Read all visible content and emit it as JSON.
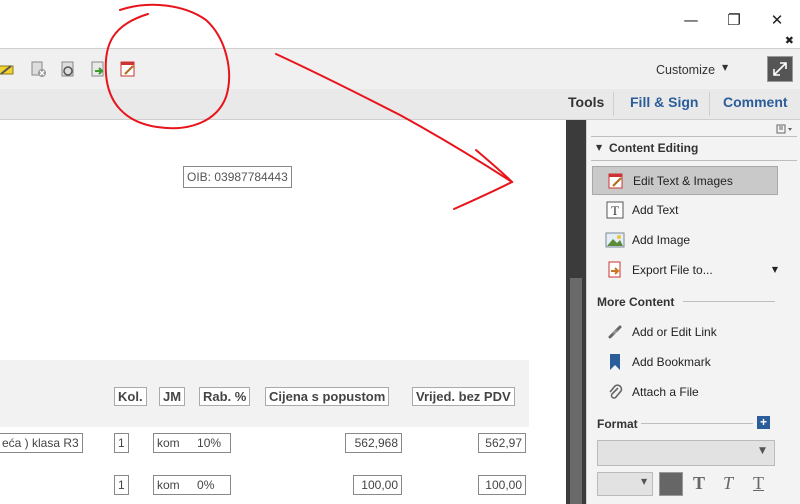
{
  "window": {
    "minimize": "—",
    "restore": "❐",
    "close": "✕",
    "doc_close": "✖"
  },
  "toolbar": {
    "icons": [
      "highlight-icon",
      "delete-page-icon",
      "attach-icon",
      "export-icon",
      "edit-text-icon"
    ],
    "customize_label": "Customize",
    "customize_caret": "▼"
  },
  "tasks": {
    "tools": "Tools",
    "fill_sign": "Fill & Sign",
    "comment": "Comment"
  },
  "document": {
    "oib": "OIB: 03987784443",
    "headers": [
      "Kol.",
      "JM",
      "Rab. %",
      "Cijena s popustom",
      "Vrijed. bez PDV"
    ],
    "rows": [
      {
        "desc": "eća ) klasa R3",
        "kol": "1",
        "jm": "kom",
        "rab": "10%",
        "cijena": "562,968",
        "vrijed": "562,97"
      },
      {
        "desc": "",
        "kol": "1",
        "jm": "kom",
        "rab": "0%",
        "cijena": "100,00",
        "vrijed": "100,00"
      }
    ]
  },
  "pane": {
    "content_editing": "Content Editing",
    "items": [
      {
        "label": "Edit Text & Images",
        "icon": "edit-text-images-icon"
      },
      {
        "label": "Add Text",
        "icon": "add-text-icon"
      },
      {
        "label": "Add Image",
        "icon": "add-image-icon"
      },
      {
        "label": "Export File to...",
        "icon": "export-file-icon"
      }
    ],
    "more_content": "More Content",
    "more_items": [
      {
        "label": "Add or Edit Link",
        "icon": "link-icon"
      },
      {
        "label": "Add Bookmark",
        "icon": "bookmark-icon"
      },
      {
        "label": "Attach a File",
        "icon": "paperclip-icon"
      }
    ],
    "format": "Format",
    "format_plus": "+",
    "font_styles": [
      "T",
      "T",
      "T"
    ]
  },
  "colors": {
    "annotation": "#e8141b",
    "selected_item": "#c9c9c9",
    "accent": "#2a5d99"
  }
}
